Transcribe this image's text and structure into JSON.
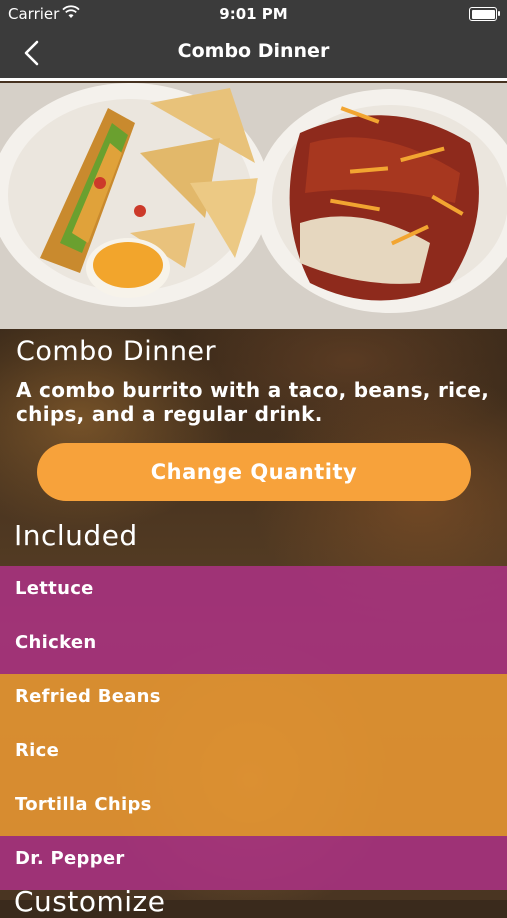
{
  "status_bar": {
    "carrier": "Carrier",
    "time": "9:01 PM"
  },
  "nav": {
    "title": "Combo Dinner"
  },
  "item": {
    "title": "Combo Dinner",
    "description": "A combo burrito with a taco, beans, rice, chips, and a regular drink."
  },
  "quantity_button": {
    "label": "Change Quantity"
  },
  "included": {
    "title": "Included",
    "items": [
      {
        "label": "Lettuce",
        "color": "#aa3282"
      },
      {
        "label": "Chicken",
        "color": "#aa3282"
      },
      {
        "label": "Refried Beans",
        "color": "#e69632"
      },
      {
        "label": "Rice",
        "color": "#e69632"
      },
      {
        "label": "Tortilla Chips",
        "color": "#e69632"
      },
      {
        "label": "Dr. Pepper",
        "color": "#aa3282"
      }
    ]
  },
  "next_section": {
    "title": "Customize"
  },
  "colors": {
    "accent": "#f7a23b",
    "purple": "#aa3282",
    "orange": "#e69632",
    "bar": "#3b3b3b"
  }
}
